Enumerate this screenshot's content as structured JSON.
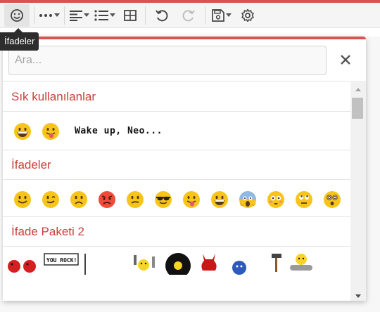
{
  "toolbar": {
    "buttons": [
      {
        "icon": "smiley-icon",
        "active": true
      },
      {
        "icon": "more-horizontal-icon"
      },
      {
        "icon": "align-left-icon"
      },
      {
        "icon": "bulleted-list-icon"
      },
      {
        "icon": "table-icon"
      },
      {
        "icon": "undo-icon"
      },
      {
        "icon": "redo-icon"
      },
      {
        "icon": "save-icon"
      },
      {
        "icon": "gear-icon"
      }
    ]
  },
  "tooltip": {
    "text": "İfadeler"
  },
  "search": {
    "placeholder": "Ara..."
  },
  "sections": {
    "frequent": {
      "title": "Sık kullanılanlar",
      "text_smiley": "Wake up, Neo..."
    },
    "emotes": {
      "title": "İfadeler"
    },
    "pack2": {
      "title": "İfade Paketi 2",
      "note_text": "YOU ROCK!"
    }
  },
  "colors": {
    "accent": "#d9534f",
    "section_title": "#c9403b",
    "emoji_face": "#f7c51a"
  }
}
